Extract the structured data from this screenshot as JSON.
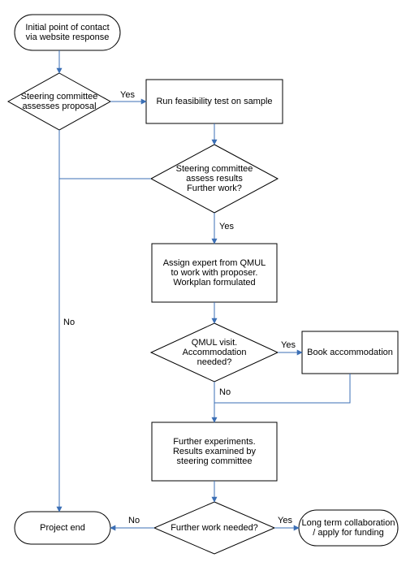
{
  "flowchart": {
    "nodes": {
      "start": {
        "type": "terminator",
        "label": "Initial point of contact\nvia website response"
      },
      "assess": {
        "type": "decision",
        "label": "Steering committee\nassesses proposal"
      },
      "feasibility": {
        "type": "process",
        "label": "Run feasibility test on sample"
      },
      "results": {
        "type": "decision",
        "label": "Steering committee\nassess results\nFurther work?"
      },
      "assign": {
        "type": "process",
        "label": "Assign expert from QMUL\nto work with proposer.\nWorkplan formulated"
      },
      "visit": {
        "type": "decision",
        "label": "QMUL visit.\nAccommodation needed?"
      },
      "book": {
        "type": "process",
        "label": "Book accommodation"
      },
      "experiments": {
        "type": "process",
        "label": "Further experiments.\nResults examined by\nsteering committee"
      },
      "further": {
        "type": "decision",
        "label": "Further work needed?"
      },
      "end": {
        "type": "terminator",
        "label": "Project end"
      },
      "collab": {
        "type": "terminator",
        "label": "Long term collaboration\n/ apply for funding"
      }
    },
    "edges": {
      "yes": "Yes",
      "no": "No"
    }
  }
}
